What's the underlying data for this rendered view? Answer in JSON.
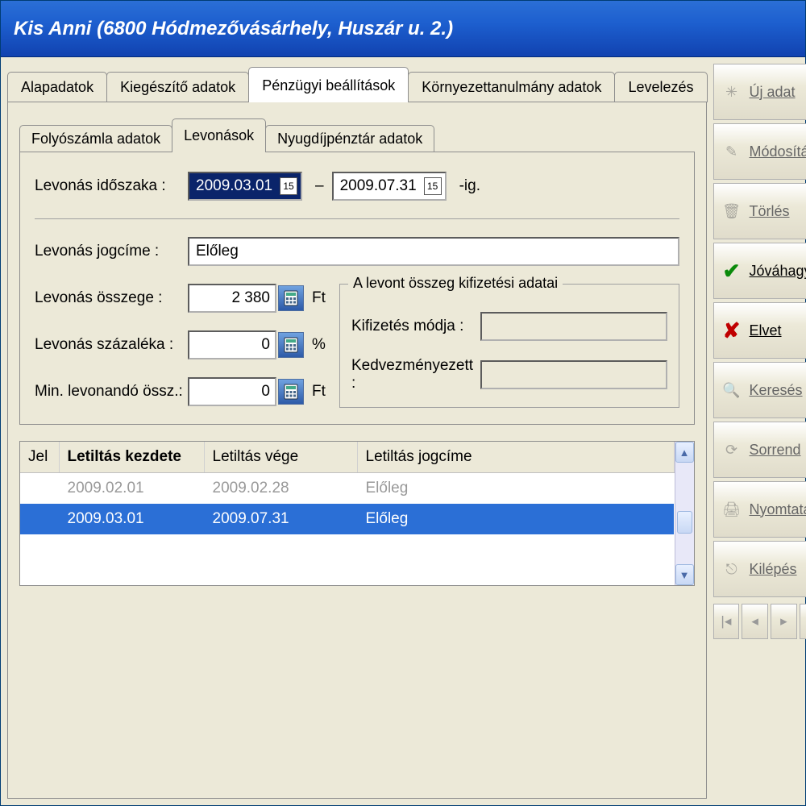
{
  "title": "Kis Anni (6800 Hódmezővásárhely, Huszár u. 2.)",
  "main_tabs": {
    "t0": "Alapadatok",
    "t1": "Kiegészítő adatok",
    "t2": "Pénzügyi beállítások",
    "t3": "Környezettanulmány adatok",
    "t4": "Levelezés"
  },
  "sub_tabs": {
    "s0": "Folyószámla adatok",
    "s1": "Levonások",
    "s2": "Nyugdíjpénztár adatok"
  },
  "labels": {
    "idoszak": "Levonás időszaka :",
    "dash": "–",
    "ig": "-ig.",
    "jogcim": "Levonás jogcíme :",
    "osszeg": "Levonás összege :",
    "szazalek": "Levonás százaléka :",
    "minlev": "Min. levonandó össz.:",
    "ft": "Ft",
    "pct": "%",
    "fieldset": "A levont összeg kifizetési adatai",
    "kifmod": "Kifizetés módja :",
    "kedv": "Kedvezményezett :"
  },
  "values": {
    "date_from": "2009.03.01",
    "date_to": "2009.07.31",
    "jogcim": "Előleg",
    "osszeg": "2 380",
    "szazalek": "0",
    "minlev": "0",
    "kifmod": "",
    "kedv": ""
  },
  "grid": {
    "headers": {
      "jel": "Jel",
      "kezd": "Letiltás kezdete",
      "vege": "Letiltás vége",
      "jog": "Letiltás jogcíme"
    },
    "rows": [
      {
        "jel": "",
        "kezd": "2009.02.01",
        "vege": "2009.02.28",
        "jog": "Előleg",
        "selected": false
      },
      {
        "jel": "",
        "kezd": "2009.03.01",
        "vege": "2009.07.31",
        "jog": "Előleg",
        "selected": true
      }
    ]
  },
  "sidebar": {
    "uj": "Új adat",
    "mod": "Módosítás",
    "torles": "Törlés",
    "jovahagy": "Jóváhagy",
    "elvet": "Elvet",
    "kereses": "Keresés",
    "sorrend": "Sorrend",
    "nyomtatas": "Nyomtatás",
    "kilepes": "Kilépés"
  },
  "calendar_glyph": "15"
}
